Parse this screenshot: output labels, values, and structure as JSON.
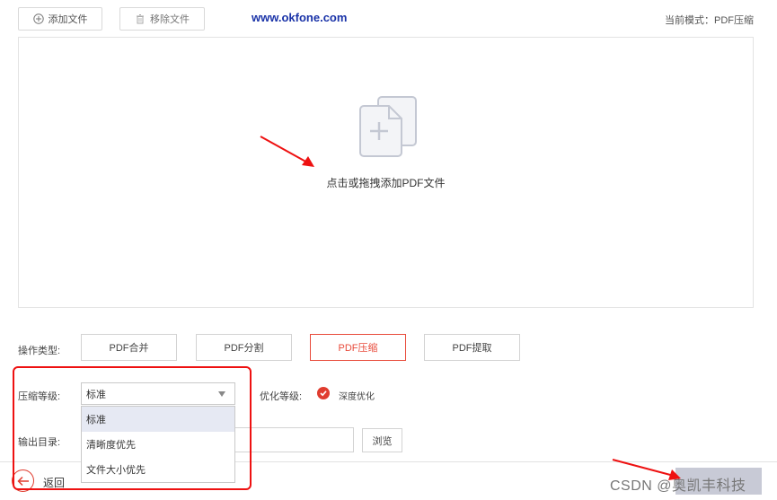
{
  "toolbar": {
    "add_label": "添加文件",
    "remove_label": "移除文件",
    "site_text": "www.okfone.com",
    "mode_text": "当前模式：PDF压缩"
  },
  "dropzone": {
    "hint": "点击或拖拽添加PDF文件"
  },
  "operation": {
    "label": "操作类型:",
    "buttons": [
      "PDF合并",
      "PDF分割",
      "PDF压缩",
      "PDF提取"
    ],
    "active": "PDF压缩"
  },
  "compression": {
    "label": "压缩等级:",
    "selected": "标准",
    "options": [
      "标准",
      "清晰度优先",
      "文件大小优先"
    ]
  },
  "optimization": {
    "label": "优化等级:",
    "option": "深度优化",
    "checked": true
  },
  "output": {
    "label": "输出目录:",
    "browse_label": "浏览"
  },
  "footer": {
    "back_label": "返回",
    "watermark": "CSDN @奥凯丰科技"
  },
  "colors": {
    "accent": "#e84a3a",
    "site": "#1a33a8",
    "annotation": "#ee1111"
  }
}
